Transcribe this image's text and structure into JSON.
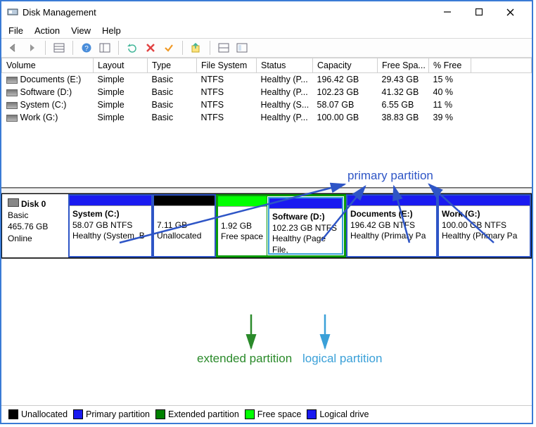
{
  "window": {
    "title": "Disk Management"
  },
  "menu": {
    "file": "File",
    "action": "Action",
    "view": "View",
    "help": "Help"
  },
  "columns": {
    "volume": "Volume",
    "layout": "Layout",
    "type": "Type",
    "fs": "File System",
    "status": "Status",
    "capacity": "Capacity",
    "free": "Free Spa...",
    "pct": "% Free"
  },
  "volumes": [
    {
      "name": "Documents (E:)",
      "layout": "Simple",
      "type": "Basic",
      "fs": "NTFS",
      "status": "Healthy (P...",
      "capacity": "196.42 GB",
      "free": "29.43 GB",
      "pct": "15 %"
    },
    {
      "name": "Software (D:)",
      "layout": "Simple",
      "type": "Basic",
      "fs": "NTFS",
      "status": "Healthy (P...",
      "capacity": "102.23 GB",
      "free": "41.32 GB",
      "pct": "40 %"
    },
    {
      "name": "System (C:)",
      "layout": "Simple",
      "type": "Basic",
      "fs": "NTFS",
      "status": "Healthy (S...",
      "capacity": "58.07 GB",
      "free": "6.55 GB",
      "pct": "11 %"
    },
    {
      "name": "Work (G:)",
      "layout": "Simple",
      "type": "Basic",
      "fs": "NTFS",
      "status": "Healthy (P...",
      "capacity": "100.00 GB",
      "free": "38.83 GB",
      "pct": "39 %"
    }
  ],
  "disk": {
    "label": "Disk 0",
    "type": "Basic",
    "size": "465.76 GB",
    "state": "Online",
    "parts": {
      "system": {
        "title": "System  (C:)",
        "l1": "58.07 GB NTFS",
        "l2": "Healthy (System, B"
      },
      "unalloc": {
        "l1": "7.11 GB",
        "l2": "Unallocated"
      },
      "freeext": {
        "l1": "1.92 GB",
        "l2": "Free space"
      },
      "software": {
        "title": "Software  (D:)",
        "l1": "102.23 GB NTFS",
        "l2": "Healthy (Page File,"
      },
      "docs": {
        "title": "Documents  (E:)",
        "l1": "196.42 GB NTFS",
        "l2": "Healthy (Primary Pa"
      },
      "work": {
        "title": "Work  (G:)",
        "l1": "100.00 GB NTFS",
        "l2": "Healthy (Primary Pa"
      }
    }
  },
  "legend": {
    "unalloc": "Unallocated",
    "primary": "Primary partition",
    "extended": "Extended partition",
    "free": "Free space",
    "logical": "Logical drive"
  },
  "annot": {
    "primary": "primary partition",
    "extended": "extended partition",
    "logical": "logical partition"
  },
  "colors": {
    "blue": "#1a1af0",
    "black": "#000",
    "green": "#00a000",
    "lime": "#00ff00",
    "logical": "#4aa3ff",
    "frame": "#3a5bd5",
    "annotBlue": "#2e55c6",
    "annotGreen": "#2a8a2a",
    "annotCyan": "#3aa0d8"
  }
}
